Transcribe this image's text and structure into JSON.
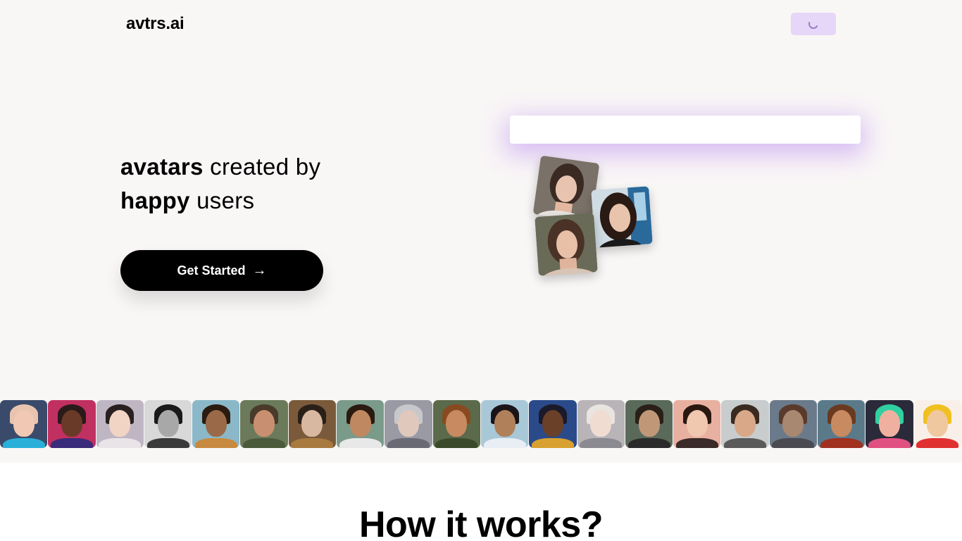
{
  "header": {
    "logo": "avtrs.ai",
    "nav_button_state": "loading"
  },
  "hero": {
    "headline_line1_bold": "avatars",
    "headline_line1_rest": " created by",
    "headline_line2_bold": "happy",
    "headline_line2_rest": " users",
    "cta_label": "Get Started",
    "cta_arrow": "→",
    "prompt_value": ""
  },
  "gallery": {
    "thumbnails": [
      {
        "bg": "#3a4a6a",
        "hair": "#e8c4b0",
        "skin": "#f0c8b4",
        "body": "#2ab0d8"
      },
      {
        "bg": "#c03060",
        "hair": "#2a1a1a",
        "skin": "#6a3a28",
        "body": "#3a2a7a"
      },
      {
        "bg": "#bfb6c4",
        "hair": "#2a2020",
        "skin": "#f2d4c4",
        "body": "#e8e4e8"
      },
      {
        "bg": "#d8d8d8",
        "hair": "#1a1a1a",
        "skin": "#a8a8a8",
        "body": "#3a3a3a"
      },
      {
        "bg": "#8ab8c8",
        "hair": "#2a1a10",
        "skin": "#9a6a48",
        "body": "#c88a40"
      },
      {
        "bg": "#6a7a5a",
        "hair": "#4a3a2a",
        "skin": "#c89070",
        "body": "#4a5a3a"
      },
      {
        "bg": "#7a5a3a",
        "hair": "#2a2018",
        "skin": "#d8b8a0",
        "body": "#a87a40"
      },
      {
        "bg": "#7a9a8a",
        "hair": "#2a1a10",
        "skin": "#c08860",
        "body": "#e8e8e8"
      },
      {
        "bg": "#9a9aa4",
        "hair": "#c8c8cc",
        "skin": "#e0c8bc",
        "body": "#6a6a74"
      },
      {
        "bg": "#5a6a4a",
        "hair": "#8a4a20",
        "skin": "#c88a60",
        "body": "#3a4a2a"
      },
      {
        "bg": "#a8c8d8",
        "hair": "#1a1418",
        "skin": "#b0805a",
        "body": "#e8eef4"
      },
      {
        "bg": "#2a4a8a",
        "hair": "#1a1a2a",
        "skin": "#6a4028",
        "body": "#d8a030"
      },
      {
        "bg": "#b8b4b8",
        "hair": "#e8e4e0",
        "skin": "#f0dcd0",
        "body": "#8a8a90"
      },
      {
        "bg": "#5a6a5a",
        "hair": "#2a2018",
        "skin": "#c09878",
        "body": "#2a2a2a"
      },
      {
        "bg": "#e8b0a0",
        "hair": "#2a1810",
        "skin": "#f0c8b0",
        "body": "#3a2a28"
      },
      {
        "bg": "#c8cccc",
        "hair": "#3a2a20",
        "skin": "#d8a888",
        "body": "#5a5a5a"
      },
      {
        "bg": "#6a7a8a",
        "hair": "#5a3a2a",
        "skin": "#a88870",
        "body": "#4a4a50"
      },
      {
        "bg": "#5a7a8a",
        "hair": "#6a3a20",
        "skin": "#c88a60",
        "body": "#a03020"
      },
      {
        "bg": "#2a2a3a",
        "hair": "#30d0a0",
        "skin": "#f0b0a0",
        "body": "#e05080"
      },
      {
        "bg": "#f8f0e8",
        "hair": "#f0c020",
        "skin": "#f0c8a0",
        "body": "#e03030"
      }
    ]
  },
  "section": {
    "title": "How it works?"
  }
}
